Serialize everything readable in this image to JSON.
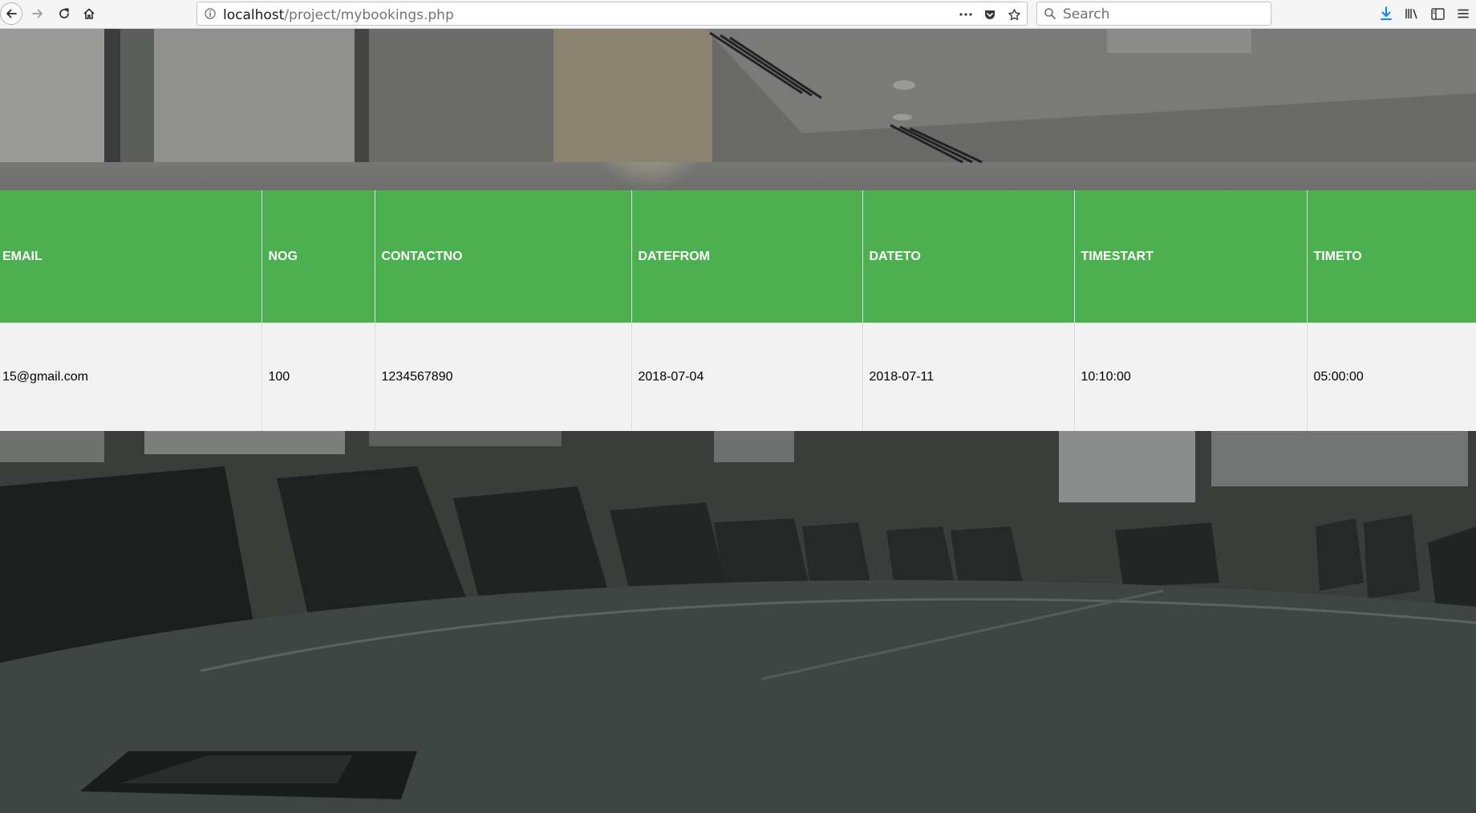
{
  "browser": {
    "url_host": "localhost",
    "url_path": "/project/mybookings.php",
    "search_placeholder": "Search"
  },
  "colors": {
    "header_bg": "#4caf50",
    "row_bg": "#f2f2f2",
    "header_text": "#ffffff"
  },
  "table": {
    "headers": [
      "EMAIL",
      "NOG",
      "CONTACTNO",
      "DATEFROM",
      "DATETO",
      "TIMESTART",
      "TIMETO"
    ],
    "rows": [
      [
        "15@gmail.com",
        "100",
        "1234567890",
        "2018-07-04",
        "2018-07-11",
        "10:10:00",
        "05:00:00"
      ]
    ]
  }
}
